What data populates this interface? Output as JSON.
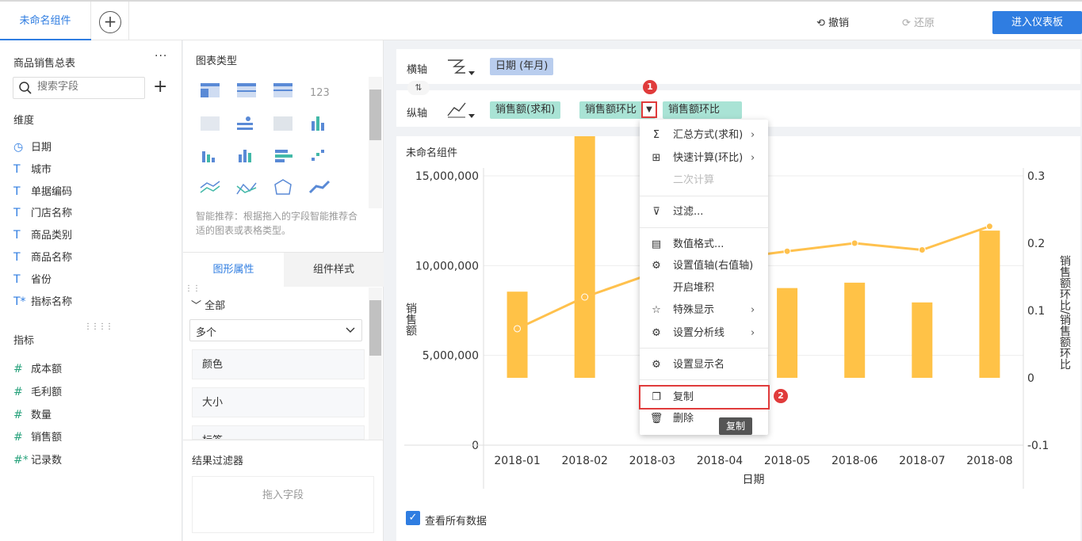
{
  "topbar": {
    "tab_label": "未命名组件",
    "undo": "撤销",
    "redo": "还原",
    "enter_dashboard": "进入仪表板"
  },
  "left": {
    "dataset_title": "商品销售总表",
    "more": "···",
    "search_placeholder": "搜索字段",
    "dimensions_title": "维度",
    "dimensions": [
      {
        "icon": "clock",
        "label": "日期"
      },
      {
        "icon": "T",
        "label": "城市"
      },
      {
        "icon": "T",
        "label": "单据编码"
      },
      {
        "icon": "T",
        "label": "门店名称"
      },
      {
        "icon": "T",
        "label": "商品类别"
      },
      {
        "icon": "T",
        "label": "商品名称"
      },
      {
        "icon": "T",
        "label": "省份"
      },
      {
        "icon": "T*",
        "label": "指标名称"
      }
    ],
    "measures_title": "指标",
    "measures": [
      {
        "icon": "#",
        "label": "成本额"
      },
      {
        "icon": "#",
        "label": "毛利额"
      },
      {
        "icon": "#",
        "label": "数量"
      },
      {
        "icon": "#",
        "label": "销售额"
      },
      {
        "icon": "#*",
        "label": "记录数"
      }
    ]
  },
  "middle": {
    "chart_types_title": "图表类型",
    "smart_tip": "智能推荐：根据拖入的字段智能推荐合适的图表或表格类型。",
    "tab_shape": "图形属性",
    "tab_style": "组件样式",
    "all": "全部",
    "dropdown_value": "多个",
    "props": [
      "颜色",
      "大小",
      "标签"
    ],
    "result_filter": "结果过滤器",
    "drop_field": "拖入字段"
  },
  "axis": {
    "x_label": "横轴",
    "y_label": "纵轴",
    "x_fields": [
      "日期 (年月)"
    ],
    "y_fields": [
      "销售额(求和)",
      "销售额环比",
      "销售额环比"
    ]
  },
  "chart": {
    "name": "未命名组件",
    "view_all": "查看所有数据"
  },
  "chart_data": {
    "type": "bar",
    "categories": [
      "2018-01",
      "2018-02",
      "2018-03",
      "2018-04",
      "2018-05",
      "2018-06",
      "2018-07",
      "2018-08"
    ],
    "series": [
      {
        "name": "销售额(求和)",
        "type": "bar",
        "axis": "left",
        "values": [
          4800000,
          13500000,
          7500000,
          5300000,
          5000000,
          5300000,
          4200000,
          8200000
        ]
      },
      {
        "name": "销售额环比",
        "type": "line",
        "axis": "right",
        "values": [
          0.073,
          0.12,
          0.155,
          0.175,
          0.188,
          0.2,
          0.19,
          0.225
        ]
      }
    ],
    "xlabel": "日期",
    "ylabel": "销售额",
    "y2label": "销售额环比/销售额环比",
    "ylim": [
      0,
      15000000
    ],
    "y_ticks": [
      "15,000,000",
      "10,000,000",
      "5,000,000",
      "0"
    ],
    "y2lim": [
      -0.1,
      0.3
    ],
    "y2_ticks": [
      "0.3",
      "0.2",
      "0.1",
      "0",
      "-0.1"
    ]
  },
  "menu": {
    "items": [
      "汇总方式(求和)",
      "快速计算(环比)",
      "二次计算",
      "过滤...",
      "数值格式...",
      "设置值轴(右值轴)",
      "开启堆积",
      "特殊显示",
      "设置分析线",
      "设置显示名",
      "复制",
      "删除"
    ],
    "tooltip": "复制",
    "badge1": "1",
    "badge2": "2"
  },
  "colors": {
    "accent": "#2f7de1",
    "bar": "#ffc247",
    "line": "#ffc14d",
    "highlight": "#e03b3b"
  }
}
